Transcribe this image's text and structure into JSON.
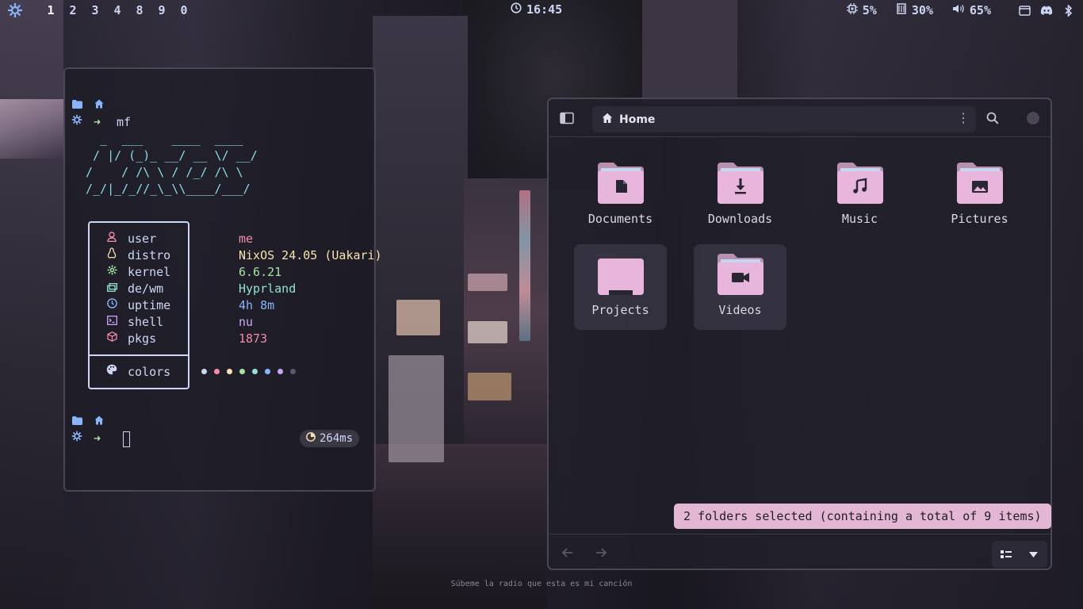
{
  "colors": {
    "accent": "#89b4fa",
    "pink": "#f38ba8",
    "yellow": "#f9e2af",
    "green": "#a6e3a1",
    "teal": "#94e2d5",
    "blue": "#89b4fa",
    "mauve": "#cba6f7",
    "status_bg": "#e3b6d3"
  },
  "topbar": {
    "workspaces": [
      "1",
      "2",
      "3",
      "4",
      "8",
      "9",
      "0"
    ],
    "clock": "16:45",
    "cpu": "5%",
    "memory": "30%",
    "volume": "65%"
  },
  "terminal": {
    "prompt_cmd": "mf",
    "ascii_art": "  _  ___    ____  ____\n / |/ (_)_ __/ __ \\/ __/\n/    / /\\ \\ / /_/ /\\ \\\n/_/|_/_//_\\_\\\\____/___/",
    "fetch": [
      {
        "key": "user",
        "value": "me",
        "icon": "user-icon",
        "color": "#f38ba8"
      },
      {
        "key": "distro",
        "value": "NixOS 24.05 (Uakari)",
        "icon": "linux-icon",
        "color": "#f9e2af"
      },
      {
        "key": "kernel",
        "value": "6.6.21",
        "icon": "gear-icon",
        "color": "#a6e3a1"
      },
      {
        "key": "de/wm",
        "value": "Hyprland",
        "icon": "window-icon",
        "color": "#94e2d5"
      },
      {
        "key": "uptime",
        "value": "4h 8m",
        "icon": "clock-icon",
        "color": "#89b4fa"
      },
      {
        "key": "shell",
        "value": "nu",
        "icon": "terminal-icon",
        "color": "#cba6f7"
      },
      {
        "key": "pkgs",
        "value": "1873",
        "icon": "package-icon",
        "color": "#f38ba8"
      }
    ],
    "colors_label": "colors",
    "palette": [
      "#cdd6f4",
      "#f38ba8",
      "#f9e2af",
      "#a6e3a1",
      "#94e2d5",
      "#89b4fa",
      "#cba6f7",
      "#585b70"
    ],
    "timer": "264ms"
  },
  "files": {
    "location": "Home",
    "folders": [
      {
        "name": "Documents",
        "icon": "document-icon",
        "selected": false
      },
      {
        "name": "Downloads",
        "icon": "download-icon",
        "selected": false
      },
      {
        "name": "Music",
        "icon": "music-icon",
        "selected": false
      },
      {
        "name": "Pictures",
        "icon": "picture-icon",
        "selected": false
      },
      {
        "name": "Projects",
        "icon": "folder-icon",
        "selected": true
      },
      {
        "name": "Videos",
        "icon": "video-icon",
        "selected": true
      }
    ],
    "status": "2 folders selected (containing a total of 9 items)"
  },
  "caption": "Súbeme la radio que esta es mi canción"
}
